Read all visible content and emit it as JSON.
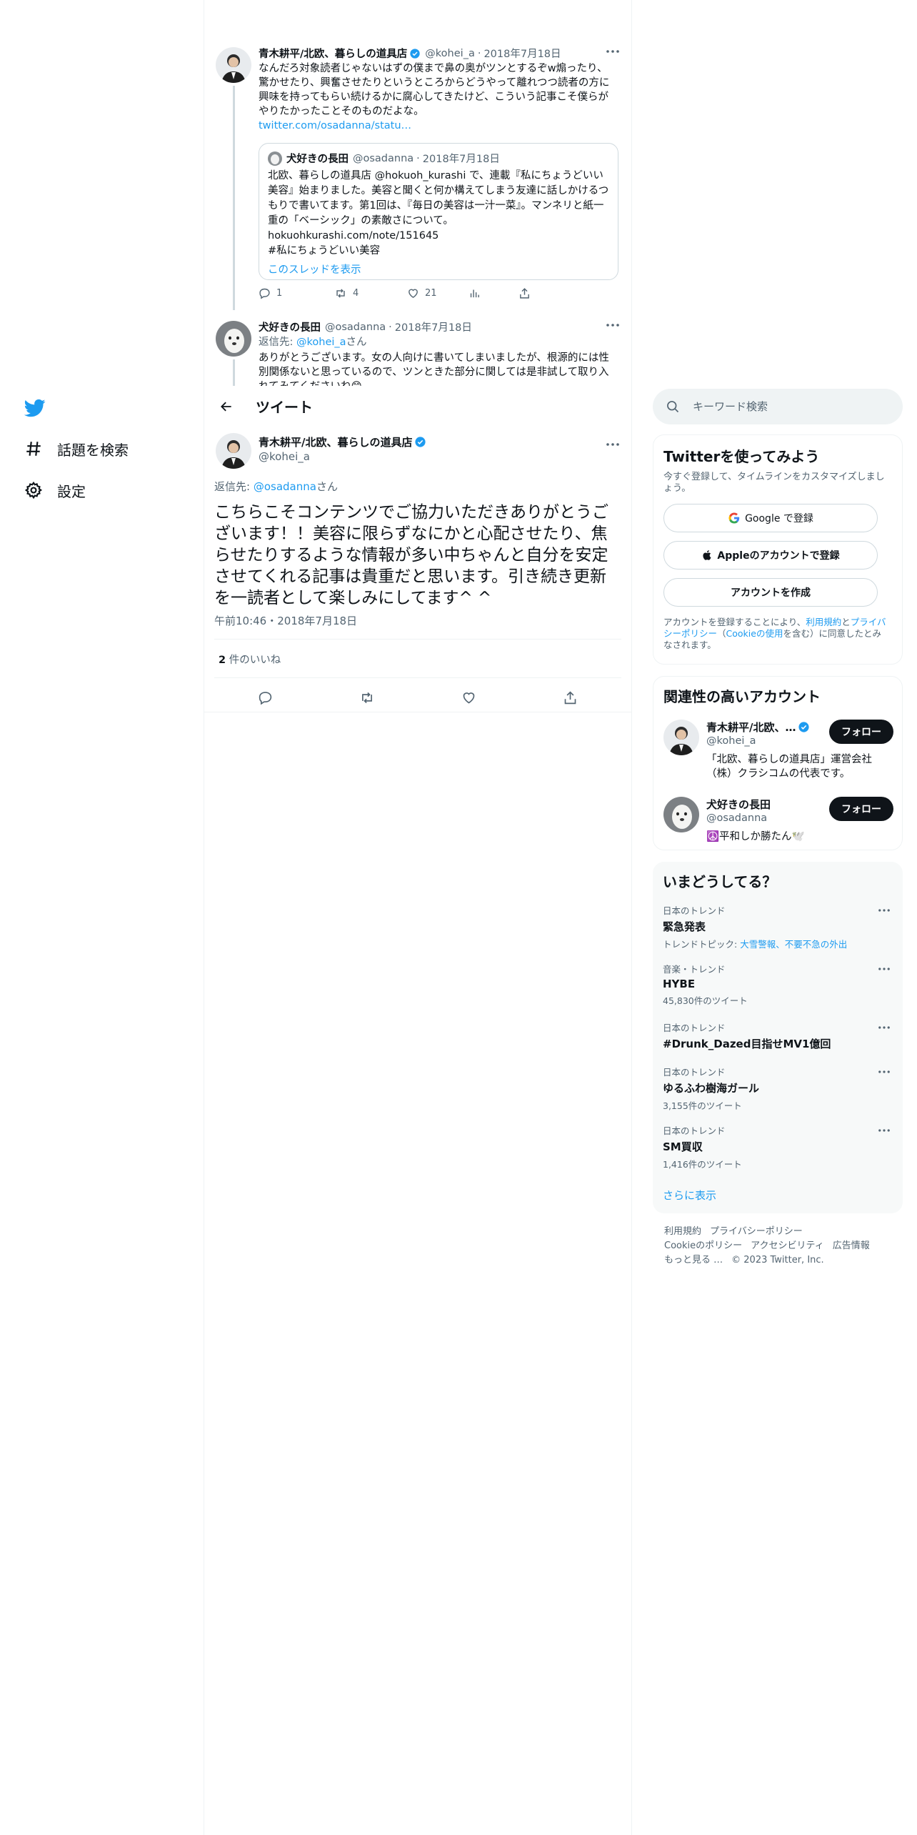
{
  "nav": {
    "explore_label": "話題を検索",
    "settings_label": "設定"
  },
  "thread": {
    "tweet1": {
      "name": "青木耕平/北欧、暮らしの道具店",
      "handle": "@kohei_a",
      "date": "2018年7月18日",
      "text": "なんだろ対象読者じゃないはずの僕まで鼻の奥がツンとするぞw煽ったり、驚かせたり、興奮させたりというところからどうやって離れつつ読者の方に興味を持ってもらい続けるかに腐心してきたけど、こういう記事こそ僕らがやりたかったことそのものだよな。",
      "link": "twitter.com/osadanna/statu…",
      "quote": {
        "name": "犬好きの長田",
        "handle": "@osadanna",
        "date": "2018年7月18日",
        "text": "北欧、暮らしの道具店 @hokuoh_kurashi で、連載『私にちょうどいい美容』始まりました。美容と聞くと何か構えてしまう友達に話しかけるつもりで書いてます。第1回は、『毎日の美容は一汁一菜』。マンネリと紙一重の「ベーシック」の素敵さについて。hokuohkurashi.com/note/151645\n#私にちょうどいい美容",
        "show_thread": "このスレッドを表示"
      },
      "replies": "1",
      "retweets": "4",
      "likes": "21"
    },
    "tweet2": {
      "name": "犬好きの長田",
      "handle": "@osadanna",
      "date": "2018年7月18日",
      "reply_prefix": "返信先: ",
      "reply_to": "@kohei_a",
      "reply_suffix": "さん",
      "text": "ありがとうございます。女の人向けに書いてしまいましたが、根源的には性別関係ないと思っているので、ツンときた部分に関しては是非試して取り入れてみてくださいね😊"
    }
  },
  "header": {
    "title": "ツイート"
  },
  "main_tweet": {
    "name": "青木耕平/北欧、暮らしの道具店",
    "handle": "@kohei_a",
    "reply_prefix": "返信先: ",
    "reply_to": "@osadanna",
    "reply_suffix": "さん",
    "text": "こちらこそコンテンツでご協力いただきありがとうございます！！美容に限らずなにかと心配させたり、焦らせたりするような情報が多い中ちゃんと自分を安定させてくれる記事は貴重だと思います。引き続き更新を一読者として楽しみにしてます^ ^",
    "time": "午前10:46・2018年7月18日",
    "like_count": "2",
    "like_label": " 件のいいね"
  },
  "search": {
    "placeholder": "キーワード検索"
  },
  "signup": {
    "title": "Twitterを使ってみよう",
    "subtitle": "今すぐ登録して、タイムラインをカスタマイズしましょう。",
    "google_label": "Google で登録",
    "apple_label": "Appleのアカウントで登録",
    "create_label": "アカウントを作成",
    "terms_1": "アカウントを登録することにより、",
    "terms_link1": "利用規約",
    "terms_2": "と",
    "terms_link2": "プライバシーポリシー",
    "terms_3": "（",
    "terms_link3": "Cookieの使用",
    "terms_4": "を含む）に同意したとみなされます。"
  },
  "related": {
    "title": "関連性の高いアカウント",
    "follow_label": "フォロー",
    "accounts": [
      {
        "name": "青木耕平/北欧、…",
        "handle": "@kohei_a",
        "bio": "「北欧、暮らしの道具店」運営会社（株）クラシコムの代表です。"
      },
      {
        "name": "犬好きの長田",
        "handle": "@osadanna",
        "bio": "☮️平和しか勝たん🕊️"
      }
    ]
  },
  "trends": {
    "title": "いまどうしてる？",
    "show_more": "さらに表示",
    "items": [
      {
        "context": "日本のトレンド",
        "name": "緊急発表",
        "meta_prefix": "トレンドトピック: ",
        "meta_links": "大雪警報、不要不急の外出"
      },
      {
        "context": "音楽・トレンド",
        "name": "HYBE",
        "meta": "45,830件のツイート"
      },
      {
        "context": "日本のトレンド",
        "name": "#Drunk_Dazed目指せMV1億回",
        "meta": ""
      },
      {
        "context": "日本のトレンド",
        "name": "ゆるふわ樹海ガール",
        "meta": "3,155件のツイート"
      },
      {
        "context": "日本のトレンド",
        "name": "SM買収",
        "meta": "1,416件のツイート"
      }
    ]
  },
  "footer": {
    "links": [
      "利用規約",
      "プライバシーポリシー",
      "Cookieのポリシー",
      "アクセシビリティ",
      "広告情報",
      "もっと見る …"
    ],
    "copyright": "© 2023 Twitter, Inc."
  },
  "colors": {
    "accent": "#1d9bf0",
    "text": "#0f1419",
    "muted": "#536471",
    "border": "#eff3f4"
  }
}
